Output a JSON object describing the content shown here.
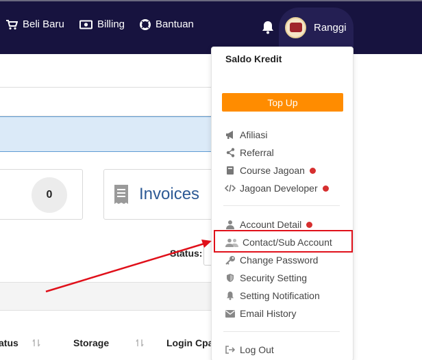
{
  "nav": {
    "items": [
      {
        "label": "Beli Baru",
        "icon": "cart-icon"
      },
      {
        "label": "Billing",
        "icon": "billing-icon"
      },
      {
        "label": "Bantuan",
        "icon": "lifebuoy-icon"
      }
    ],
    "user_name": "Ranggi"
  },
  "cards": {
    "count_value": "0",
    "invoices_label": "Invoices"
  },
  "filter": {
    "status_label": "Status:"
  },
  "table": {
    "headers": [
      "atus",
      "Storage",
      "Login Cpa"
    ]
  },
  "dropdown": {
    "title": "Saldo Kredit",
    "topup_label": "Top Up",
    "group1": [
      {
        "label": "Afiliasi",
        "icon": "megaphone-icon",
        "dot": false
      },
      {
        "label": "Referral",
        "icon": "share-icon",
        "dot": false
      },
      {
        "label": "Course Jagoan",
        "icon": "book-icon",
        "dot": true
      },
      {
        "label": "Jagoan Developer",
        "icon": "code-icon",
        "dot": true
      }
    ],
    "group2": [
      {
        "label": "Account Detail",
        "icon": "user-icon",
        "dot": true
      },
      {
        "label": "Contact/Sub Account",
        "icon": "users-icon",
        "dot": false
      },
      {
        "label": "Change Password",
        "icon": "key-icon",
        "dot": false
      },
      {
        "label": "Security Setting",
        "icon": "shield-icon",
        "dot": false
      },
      {
        "label": "Setting Notification",
        "icon": "bell-icon",
        "dot": false
      },
      {
        "label": "Email History",
        "icon": "envelope-icon",
        "dot": false
      }
    ],
    "logout_label": "Log Out"
  },
  "colors": {
    "navbar": "#17133f",
    "topup": "#ff8c00",
    "notification_dot": "#d62f2f",
    "annotation": "#e0101a",
    "link_blue": "#2d5a95"
  }
}
